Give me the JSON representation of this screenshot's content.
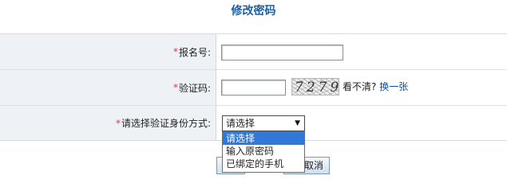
{
  "title": "修改密码",
  "form": {
    "required_mark": "*",
    "reg_label": "报名号:",
    "reg_value": "",
    "captcha_label": "验证码:",
    "captcha_value": "",
    "captcha_text": "7279",
    "captcha_hint": "看不清?",
    "captcha_refresh": "换一张",
    "method_label": "请选择验证身份方式:",
    "method_selected": "请选择",
    "method_options": [
      "请选择",
      "输入原密码",
      "已绑定的手机"
    ]
  },
  "buttons": {
    "cancel_label": "取消"
  }
}
